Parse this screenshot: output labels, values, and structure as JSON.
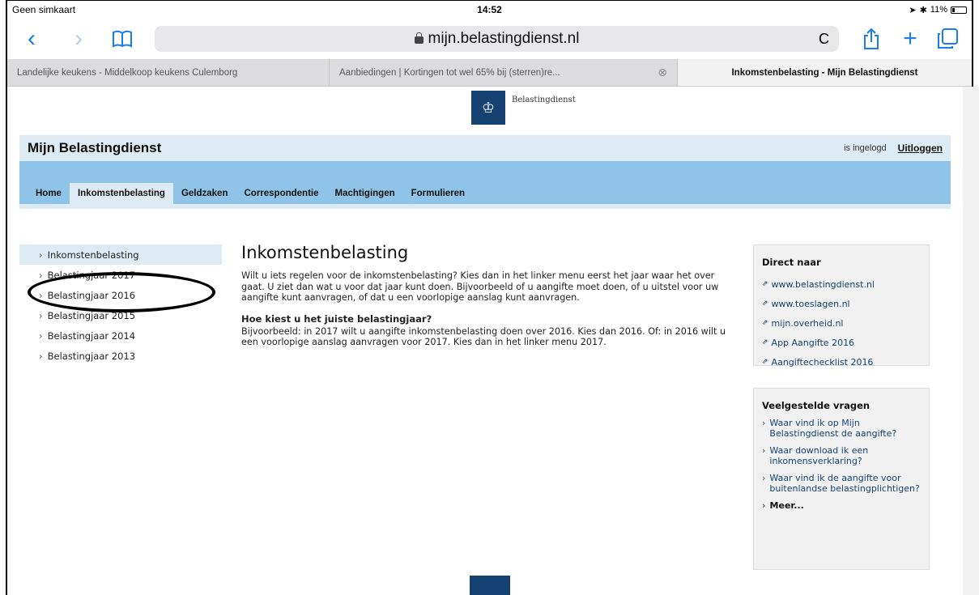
{
  "statusbar": {
    "carrier": "Geen simkaart",
    "time": "14:52",
    "battery": "11%"
  },
  "browser": {
    "url": "mijn.belastingdienst.nl",
    "tabs": [
      {
        "label": "Landelijke keukens - Middelkoop keukens Culemborg"
      },
      {
        "label": "Aanbiedingen | Kortingen tot wel 65% bij (sterren)re..."
      },
      {
        "label": "Inkomstenbelasting - Mijn Belastingdienst"
      }
    ]
  },
  "header": {
    "logo_text": "Belastingdienst",
    "brand": "Mijn Belastingdienst",
    "logged_in": "is ingelogd",
    "logout": "Uitloggen"
  },
  "nav": {
    "items": [
      "Home",
      "Inkomstenbelasting",
      "Geldzaken",
      "Correspondentie",
      "Machtigingen",
      "Formulieren"
    ],
    "active_index": 1
  },
  "sidebar": {
    "items": [
      {
        "label": "Inkomstenbelasting"
      },
      {
        "label": "Belastingjaar 2017"
      },
      {
        "label": "Belastingjaar 2016"
      },
      {
        "label": "Belastingjaar 2015"
      },
      {
        "label": "Belastingjaar 2014"
      },
      {
        "label": "Belastingjaar 2013"
      }
    ]
  },
  "main": {
    "title": "Inkomstenbelasting",
    "intro": "Wilt u iets regelen voor de inkomstenbelasting? Kies dan in het linker menu eerst het jaar waar het over gaat. U ziet dan wat u voor dat jaar kunt doen. Bijvoorbeeld of u aangifte moet doen, of u uitstel voor uw aangifte kunt aanvragen, of dat u een voorlopige aanslag kunt aanvragen.",
    "subtitle": "Hoe kiest u het juiste belastingjaar?",
    "body": "Bijvoorbeeld: in 2017 wilt u aangifte inkomstenbelasting doen over 2016. Kies dan 2016. Of: in 2016 wilt u een voorlopige aanslag aanvragen voor 2017. Kies dan in het linker menu 2017."
  },
  "direct": {
    "title": "Direct naar",
    "links": [
      "www.belastingdienst.nl",
      "www.toeslagen.nl",
      "mijn.overheid.nl",
      "App Aangifte 2016",
      "Aangiftechecklist 2016"
    ]
  },
  "faq": {
    "title": "Veelgestelde vragen",
    "items": [
      "Waar vind ik op Mijn Belastingdienst de aangifte?",
      "Waar download ik een inkomensverklaring?",
      "Waar vind ik de aangifte voor buitenlandse belastingplichtigen?"
    ],
    "more": "Meer..."
  }
}
